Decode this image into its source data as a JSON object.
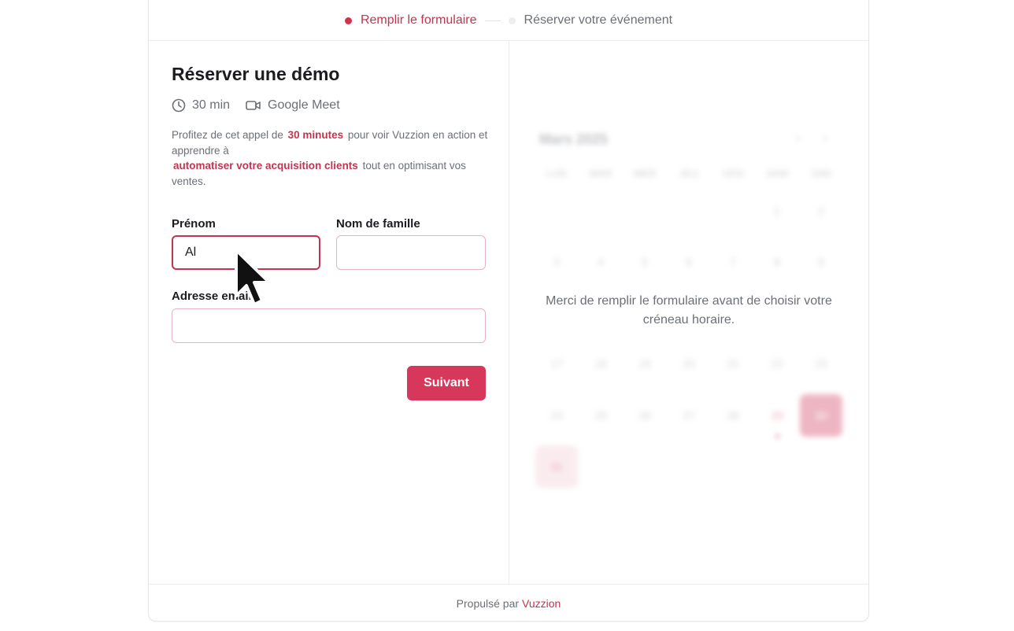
{
  "steps": [
    {
      "label": "Remplir le formulaire",
      "active": true
    },
    {
      "label": "Réserver votre événement",
      "active": false
    }
  ],
  "form": {
    "title": "Réserver une démo",
    "duration": "30 min",
    "platform": "Google Meet",
    "desc_part1": "Profitez de cet appel de",
    "desc_hl1": "30 minutes",
    "desc_part2": "pour voir Vuzzion en action et apprendre à",
    "desc_hl2": "automatiser votre acquisition clients",
    "desc_part3": "tout en optimisant vos ventes.",
    "first_name_label": "Prénom",
    "first_name_value": "Al",
    "last_name_label": "Nom de famille",
    "last_name_value": "",
    "email_label": "Adresse email",
    "email_value": "",
    "submit_label": "Suivant"
  },
  "calendar": {
    "month": "Mars 2025",
    "prev": "‹",
    "next": "›",
    "weekdays": [
      "LUN",
      "MAR",
      "MER",
      "JEU",
      "VEN",
      "SAM",
      "DIM"
    ],
    "days": [
      "1",
      "2",
      "3",
      "4",
      "5",
      "6",
      "7",
      "8",
      "9",
      "17",
      "18",
      "19",
      "20",
      "21",
      "22",
      "23",
      "24",
      "25",
      "26",
      "27",
      "28",
      "29",
      "30",
      "31"
    ],
    "message": "Merci de remplir le formulaire avant de choisir votre créneau horaire."
  },
  "footer": {
    "powered_by": "Propulsé par",
    "brand": "Vuzzion"
  },
  "colors": {
    "accent": "#d0324f",
    "button": "#d6375a",
    "muted_text": "#6b6f76"
  }
}
